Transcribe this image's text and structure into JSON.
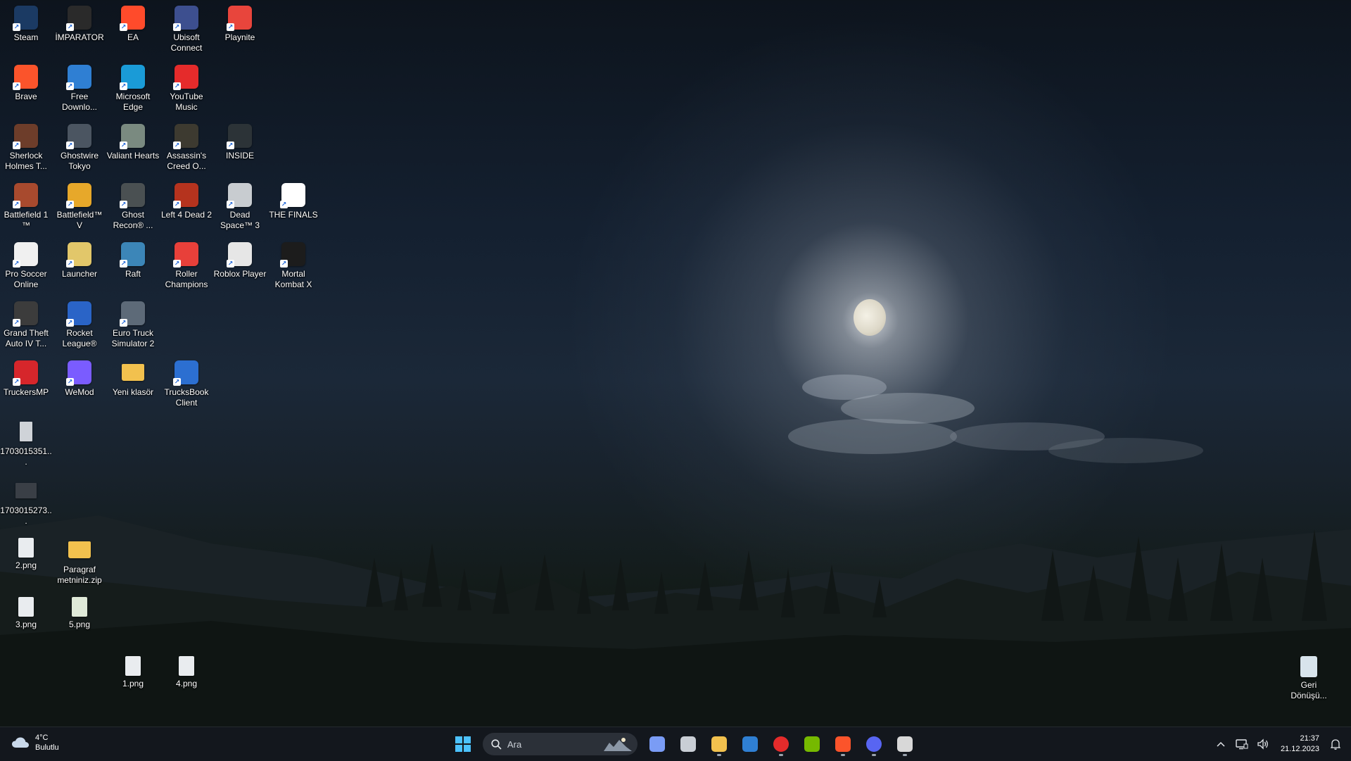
{
  "desktop": {
    "icons": [
      {
        "label": "Steam",
        "icon": "steam-icon",
        "color": "#1b3a63"
      },
      {
        "label": "İMPARATOR",
        "icon": "epic-games-icon",
        "color": "#2a2a2a"
      },
      {
        "label": "EA",
        "icon": "ea-icon",
        "color": "#ff4b2b"
      },
      {
        "label": "Ubisoft Connect",
        "icon": "ubisoft-icon",
        "color": "#3d4f8f"
      },
      {
        "label": "Playnite",
        "icon": "playnite-icon",
        "color": "#e8453c"
      },
      {
        "label": "Brave",
        "icon": "brave-icon",
        "color": "#fb542b"
      },
      {
        "label": "Free Downlo...",
        "icon": "free-download-manager-icon",
        "color": "#2f7fd3"
      },
      {
        "label": "Microsoft Edge",
        "icon": "edge-icon",
        "color": "#1a9bd7"
      },
      {
        "label": "YouTube Music",
        "icon": "youtube-music-icon",
        "color": "#e52b2b"
      },
      {
        "label": "Sherlock Holmes T...",
        "icon": "sherlock-holmes-icon",
        "color": "#6d3d2a"
      },
      {
        "label": "Ghostwire Tokyo",
        "icon": "ghostwire-tokyo-icon",
        "color": "#4b5561"
      },
      {
        "label": "Valiant Hearts",
        "icon": "valiant-hearts-icon",
        "color": "#7a8a80"
      },
      {
        "label": "Assassin's Creed O...",
        "icon": "assassins-creed-icon",
        "color": "#3d3a30"
      },
      {
        "label": "INSIDE",
        "icon": "inside-icon",
        "color": "#2c3337"
      },
      {
        "label": "Battlefield 1 ™",
        "icon": "battlefield-1-icon",
        "color": "#a84a2e"
      },
      {
        "label": "Battlefield™ V",
        "icon": "battlefield-v-icon",
        "color": "#e7a82a"
      },
      {
        "label": "Ghost Recon® ...",
        "icon": "ghost-recon-icon",
        "color": "#4a5052"
      },
      {
        "label": "Left 4 Dead 2",
        "icon": "left-4-dead-2-icon",
        "color": "#b5331e"
      },
      {
        "label": "Dead Space™ 3",
        "icon": "dead-space-3-icon",
        "color": "#c8ccd0"
      },
      {
        "label": "THE FINALS",
        "icon": "the-finals-icon",
        "color": "#ffffff"
      },
      {
        "label": "Pro Soccer Online",
        "icon": "pro-soccer-online-icon",
        "color": "#f0f0f0"
      },
      {
        "label": "Launcher",
        "icon": "launcher-icon",
        "color": "#e2c76a"
      },
      {
        "label": "Raft",
        "icon": "raft-icon",
        "color": "#3c86b8"
      },
      {
        "label": "Roller Champions",
        "icon": "roller-champions-icon",
        "color": "#e8403a"
      },
      {
        "label": "Roblox Player",
        "icon": "roblox-icon",
        "color": "#e6e6e6"
      },
      {
        "label": "Mortal Kombat X",
        "icon": "mortal-kombat-x-icon",
        "color": "#1c1c1c"
      },
      {
        "label": "Grand Theft Auto IV T...",
        "icon": "gta-iv-icon",
        "color": "#3c3c3c"
      },
      {
        "label": "Rocket League®",
        "icon": "rocket-league-icon",
        "color": "#2a64c7"
      },
      {
        "label": "Euro Truck Simulator 2",
        "icon": "euro-truck-simulator-icon",
        "color": "#5d6a78"
      },
      {
        "label": "TruckersMP",
        "icon": "truckersmp-icon",
        "color": "#d6262b"
      },
      {
        "label": "WeMod",
        "icon": "wemod-icon",
        "color": "#7a5cff"
      },
      {
        "label": "Yeni klasör",
        "icon": "folder-icon",
        "color": "#f2c14e"
      },
      {
        "label": "TrucksBook Client",
        "icon": "trucksbook-icon",
        "color": "#2c6fd1"
      },
      {
        "label": "1703015351...",
        "icon": "image-file-icon",
        "color": "#cfd3d8"
      },
      {
        "label": "1703015273...",
        "icon": "image-file-icon",
        "color": "#3a3f46"
      },
      {
        "label": "2.png",
        "icon": "png-file-icon",
        "color": "#e9ecef"
      },
      {
        "label": "Paragraf metniniz.zip",
        "icon": "zip-folder-icon",
        "color": "#f2c14e"
      },
      {
        "label": "3.png",
        "icon": "png-file-icon",
        "color": "#e9ecef"
      },
      {
        "label": "5.png",
        "icon": "png-file-icon",
        "color": "#dfe9d8"
      },
      {
        "label": "1.png",
        "icon": "png-file-icon",
        "color": "#e9ecef"
      },
      {
        "label": "4.png",
        "icon": "png-file-icon",
        "color": "#e9ecef"
      },
      {
        "label": "Geri Dönüşü...",
        "icon": "recycle-bin-icon",
        "color": "#d8e4ec"
      }
    ]
  },
  "taskbar": {
    "weather": {
      "temperature": "4°C",
      "condition": "Bulutlu",
      "icon": "cloud-icon"
    },
    "search": {
      "placeholder": "Ara",
      "icon": "search-icon"
    },
    "pinned": [
      {
        "name": "start-button",
        "icon": "windows-logo-icon",
        "color": "#3aa0f0",
        "running": false
      },
      {
        "name": "copilot-button",
        "icon": "copilot-icon",
        "color": "#7a9cf5",
        "running": false
      },
      {
        "name": "task-view-button",
        "icon": "task-view-icon",
        "color": "#c9ced5",
        "running": false
      },
      {
        "name": "file-explorer-button",
        "icon": "file-explorer-icon",
        "color": "#f2c14e",
        "running": true
      },
      {
        "name": "microsoft-store-button",
        "icon": "microsoft-store-icon",
        "color": "#2f7fd3",
        "running": false
      },
      {
        "name": "youtube-music-button",
        "icon": "youtube-music-icon",
        "color": "#e52b2b",
        "running": true
      },
      {
        "name": "nvidia-button",
        "icon": "nvidia-icon",
        "color": "#76b900",
        "running": false
      },
      {
        "name": "brave-button",
        "icon": "brave-icon",
        "color": "#fb542b",
        "running": true
      },
      {
        "name": "discord-button",
        "icon": "discord-icon",
        "color": "#5865f2",
        "running": true
      },
      {
        "name": "epic-games-button",
        "icon": "epic-games-icon",
        "color": "#d8d8d8",
        "running": true
      }
    ],
    "tray": {
      "chevron_icon": "chevron-up-icon",
      "network_icon": "network-icon",
      "volume_icon": "volume-icon",
      "notification_icon": "bell-icon",
      "time": "21:37",
      "date": "21.12.2023"
    }
  }
}
